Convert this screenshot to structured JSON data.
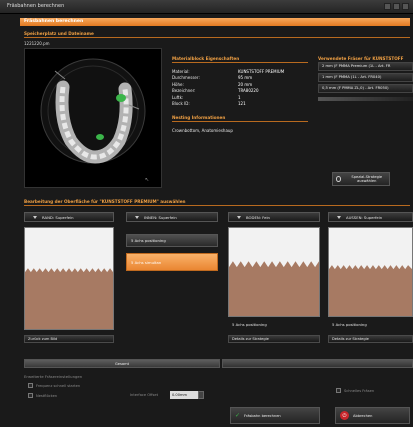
{
  "window": {
    "title": "Fräsbahnen berechnen"
  },
  "header": {
    "section_title": "Fräsbahnen berechnen",
    "storage_label": "Speicherplatz und Dateiname",
    "filename": "1221220.pm"
  },
  "material": {
    "heading": "Materialblock Eigenschaften",
    "rows": [
      {
        "key": "Material:",
        "value": "KUNSTSTOFF PREMIUM"
      },
      {
        "key": "Durchmesser:",
        "value": "95 mm"
      },
      {
        "key": "Höhe:",
        "value": "20 mm"
      },
      {
        "key": "Bezeichner:",
        "value": "TRA80220"
      },
      {
        "key": "Luftk:",
        "value": "1"
      },
      {
        "key": "Block ID:",
        "value": "121"
      }
    ]
  },
  "nesting": {
    "heading": "Nesting Informationen",
    "value": "Crownbottom, Anatomieshaup"
  },
  "tools": {
    "heading": "Verwendete Fräser für KUNSTSTOFF",
    "items": [
      "2 mm (F PMMA Premium (1L - Art. FR",
      "1 mm (F PMMA (1L - Art. FR040)",
      "0,5 mm (F PMMA ZL,0) - Art. FR050)"
    ],
    "special_button": "Spezial-Strategie auswählen"
  },
  "surface": {
    "heading": "Bearbeitung der Oberfläche für \"KUNSTSTOFF PREMIUM\" auswählen",
    "columns": [
      {
        "header": "RAND: Superfein"
      },
      {
        "header": "INNEN: Superfein"
      },
      {
        "header": "BODEN: Fein"
      },
      {
        "header": "AUSSEN: Superfein"
      }
    ],
    "options": {
      "opt1": "5 Achs positioning",
      "opt2": "5 Achs simultan"
    },
    "boden_label": "5 Achs positioning",
    "aussen_label": "5 Achs positioning",
    "boden_detail": "Details zur Strategie",
    "aussen_detail": "Details zur Strategie",
    "back_button": "Zurück zum Bild"
  },
  "footer": {
    "concept_button": "Gesamt",
    "options_heading": "Erweiterte Fräsereinstellungen",
    "checkbox1": "Frequenz schnell starten",
    "checkbox2": "Nestflöcken",
    "interface_label": "Interface Offset",
    "interface_value": "0.00mm",
    "fast_mill": "Schnelles Fräsen",
    "calc_button": "Fräsbahn berechnen",
    "cancel_button": "Abbrechen"
  }
}
